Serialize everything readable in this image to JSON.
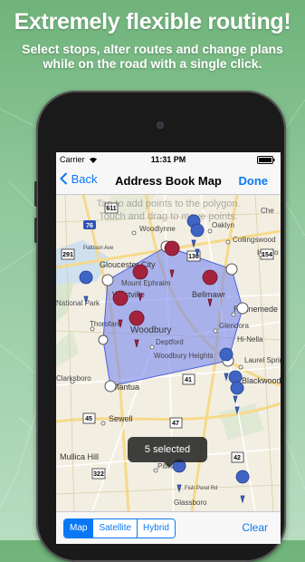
{
  "promo": {
    "headline": "Extremely flexible routing!",
    "sub_line1": "Select stops, alter routes and change plans",
    "sub_line2": "while on the road with a single click."
  },
  "status_bar": {
    "carrier": "Carrier",
    "time": "11:31 PM"
  },
  "nav": {
    "back_label": "Back",
    "title": "Address Book Map",
    "done_label": "Done"
  },
  "map": {
    "hint_line1": "Tap to add points to the polygon.",
    "hint_line2": "Touch and drag to move points.",
    "labels": {
      "woodlynne": "Woodlynne",
      "oaklyn": "Oaklyn",
      "collingswood": "Collingswood",
      "gloucester_city": "Gloucester City",
      "mount_ephraim": "Mount Ephraim",
      "westville": "Westville",
      "bellmawr": "Bellmawr",
      "national_park": "National Park",
      "thorofare": "Thorofare",
      "woodbury": "Woodbury",
      "deptford": "Deptford",
      "runnemede": "Runnemede",
      "glendora": "Glendora",
      "hi_nella": "Hi-Nella",
      "woodbury_heights": "Woodbury Heights",
      "laurel_springs": "Laurel Springs",
      "clarksboro": "Clarksboro",
      "mantua": "Mantua",
      "blackwood": "Blackwood",
      "sewell": "Sewell",
      "mullica_hill": "Mullica Hill",
      "pitman": "Pitman",
      "glassboro": "Glassboro",
      "haddon": "Haddo",
      "che": "Che",
      "patton_ave": "Pattison Ave",
      "fish_pond_rd": "Fish Pond Rd",
      "shield_611": "611",
      "shield_76": "76",
      "shield_291": "291",
      "shield_130": "130",
      "shield_154": "154",
      "shield_45": "45",
      "shield_47": "47",
      "shield_42": "42",
      "shield_322": "322",
      "shield_41": "41"
    }
  },
  "toast": {
    "text": "5 selected"
  },
  "toolbar": {
    "map_types": [
      "Map",
      "Satellite",
      "Hybrid"
    ],
    "selected_map_type": "Map",
    "clear_label": "Clear"
  },
  "colors": {
    "accent": "#0a78f5",
    "polygon_fill": "#6e7ff0",
    "selected_pin": "#a3233e",
    "unselected_pin": "#3f64c4"
  }
}
